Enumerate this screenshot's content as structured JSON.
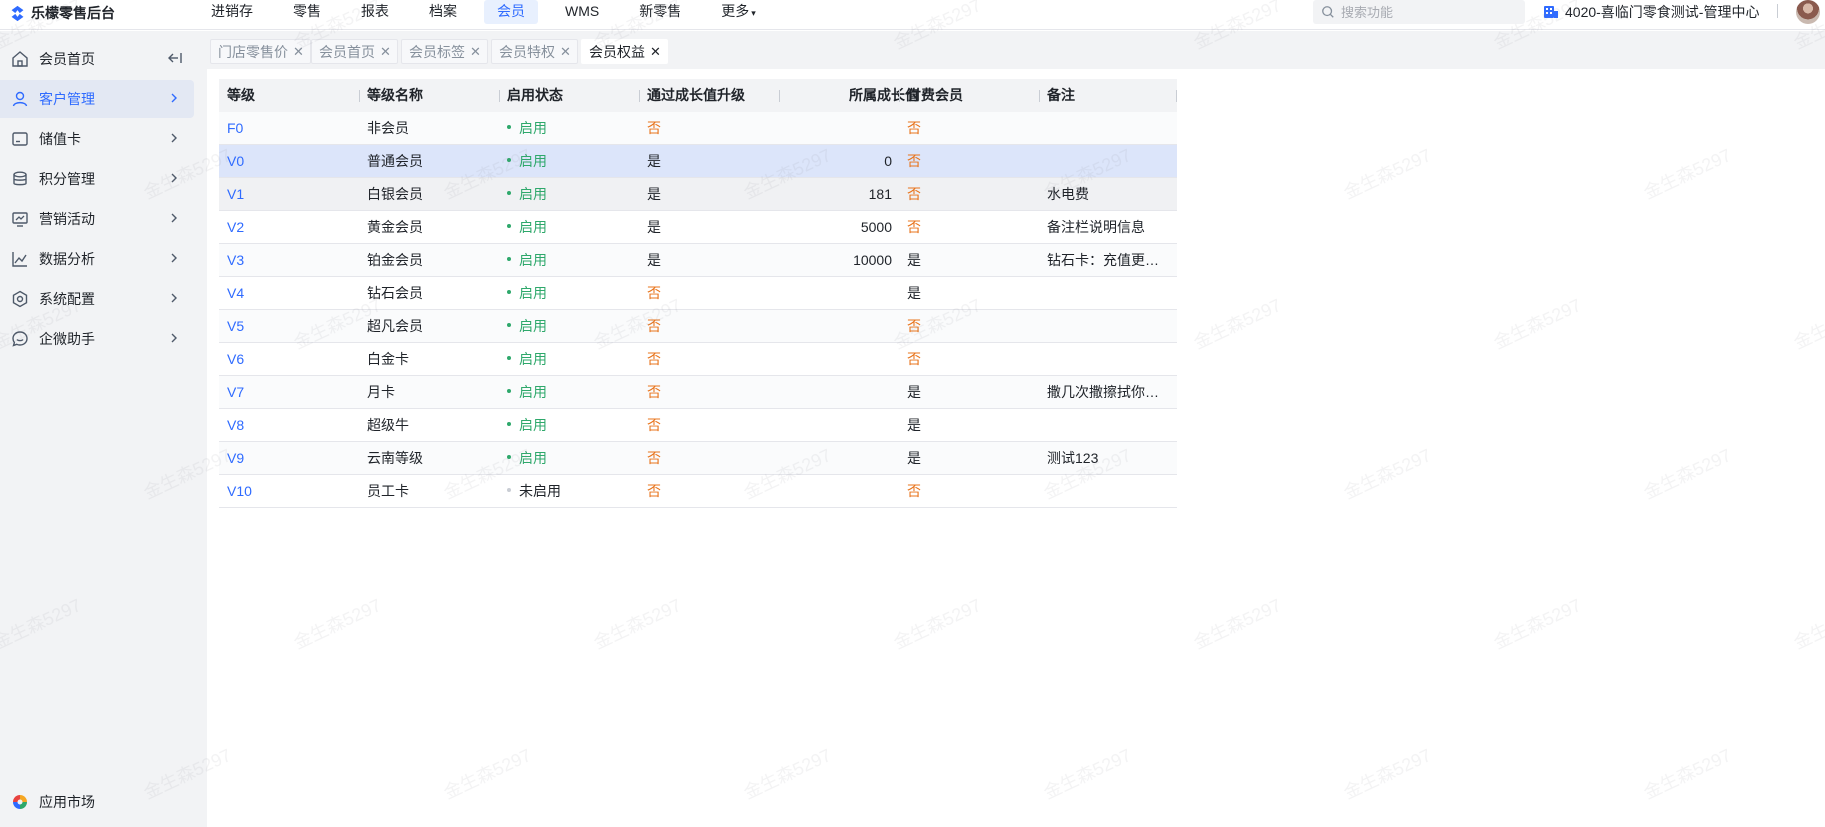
{
  "app": {
    "title": "乐檬零售后台",
    "watermark": "金生森5297"
  },
  "topnav": [
    {
      "label": "进销存",
      "active": false
    },
    {
      "label": "零售",
      "active": false
    },
    {
      "label": "报表",
      "active": false
    },
    {
      "label": "档案",
      "active": false
    },
    {
      "label": "会员",
      "active": true
    },
    {
      "label": "WMS",
      "active": false
    },
    {
      "label": "新零售",
      "active": false
    },
    {
      "label": "更多",
      "active": false
    }
  ],
  "search": {
    "placeholder": "搜索功能",
    "value": ""
  },
  "store": {
    "name": "4020-喜临门零食测试-管理中心"
  },
  "sidebar": {
    "items": [
      {
        "label": "会员首页",
        "icon": "home-icon",
        "active": false
      },
      {
        "label": "客户管理",
        "icon": "user-icon",
        "active": true
      },
      {
        "label": "储值卡",
        "icon": "card-icon",
        "active": false
      },
      {
        "label": "积分管理",
        "icon": "coins-icon",
        "active": false
      },
      {
        "label": "营销活动",
        "icon": "campaign-icon",
        "active": false
      },
      {
        "label": "数据分析",
        "icon": "chart-icon",
        "active": false
      },
      {
        "label": "系统配置",
        "icon": "settings-icon",
        "active": false
      },
      {
        "label": "企微助手",
        "icon": "chat-icon",
        "active": false
      }
    ],
    "app_market": "应用市场"
  },
  "tabs": [
    {
      "label": "门店零售价",
      "active": false
    },
    {
      "label": "会员首页",
      "active": false
    },
    {
      "label": "会员标签",
      "active": false
    },
    {
      "label": "会员特权",
      "active": false
    },
    {
      "label": "会员权益",
      "active": true
    }
  ],
  "table": {
    "columns": [
      "等级",
      "等级名称",
      "启用状态",
      "通过成长值升级",
      "所属成长值",
      "付费会员",
      "备注"
    ],
    "rows": [
      {
        "level": "F0",
        "name": "非会员",
        "status": "启用",
        "enabled": true,
        "upgrade": "否",
        "growth": "",
        "paid": "否",
        "remark": ""
      },
      {
        "level": "V0",
        "name": "普通会员",
        "status": "启用",
        "enabled": true,
        "upgrade": "是",
        "growth": "0",
        "paid": "否",
        "remark": ""
      },
      {
        "level": "V1",
        "name": "白银会员",
        "status": "启用",
        "enabled": true,
        "upgrade": "是",
        "growth": "181",
        "paid": "否",
        "remark": "水电费"
      },
      {
        "level": "V2",
        "name": "黄金会员",
        "status": "启用",
        "enabled": true,
        "upgrade": "是",
        "growth": "5000",
        "paid": "否",
        "remark": "备注栏说明信息"
      },
      {
        "level": "V3",
        "name": "铂金会员",
        "status": "启用",
        "enabled": true,
        "upgrade": "是",
        "growth": "10000",
        "paid": "是",
        "remark": "钻石卡：充值更…"
      },
      {
        "level": "V4",
        "name": "钻石会员",
        "status": "启用",
        "enabled": true,
        "upgrade": "否",
        "growth": "",
        "paid": "是",
        "remark": ""
      },
      {
        "level": "V5",
        "name": "超凡会员",
        "status": "启用",
        "enabled": true,
        "upgrade": "否",
        "growth": "",
        "paid": "否",
        "remark": ""
      },
      {
        "level": "V6",
        "name": "白金卡",
        "status": "启用",
        "enabled": true,
        "upgrade": "否",
        "growth": "",
        "paid": "否",
        "remark": ""
      },
      {
        "level": "V7",
        "name": "月卡",
        "status": "启用",
        "enabled": true,
        "upgrade": "否",
        "growth": "",
        "paid": "是",
        "remark": "撒几次撒擦拭你…"
      },
      {
        "level": "V8",
        "name": "超级牛",
        "status": "启用",
        "enabled": true,
        "upgrade": "否",
        "growth": "",
        "paid": "是",
        "remark": ""
      },
      {
        "level": "V9",
        "name": "云南等级",
        "status": "启用",
        "enabled": true,
        "upgrade": "否",
        "growth": "",
        "paid": "是",
        "remark": "测试123"
      },
      {
        "level": "V10",
        "name": "员工卡",
        "status": "未启用",
        "enabled": false,
        "upgrade": "否",
        "growth": "",
        "paid": "否",
        "remark": ""
      }
    ]
  },
  "colors": {
    "accent": "#2f6bff",
    "enabled": "#2ea86b",
    "no": "#e8741c"
  }
}
